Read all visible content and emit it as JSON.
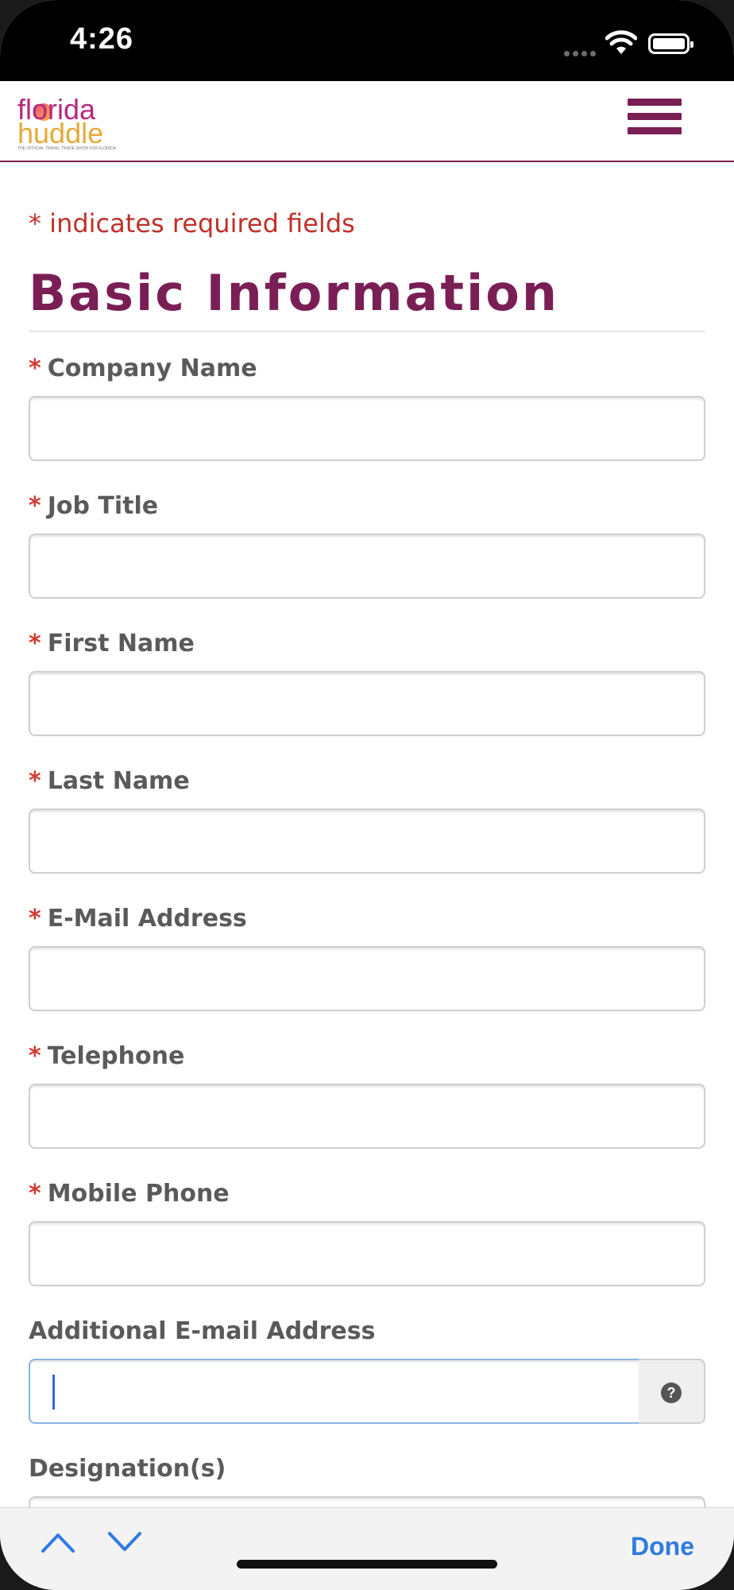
{
  "status_bar": {
    "time": "4:26",
    "icons": [
      "cellular-dots-icon",
      "wifi-icon",
      "battery-icon"
    ]
  },
  "header": {
    "logo": {
      "line1": "florida",
      "line2": "huddle",
      "tagline": "THE OFFICIAL TRAVEL TRADE SHOW FOR FLORIDA"
    },
    "menu_icon": "hamburger-menu-icon",
    "brand_color": "#7a1f55"
  },
  "form": {
    "required_note": "* indicates required fields",
    "section_title": "Basic Information",
    "required_marker": "*",
    "fields": [
      {
        "label": "Company Name",
        "required": true,
        "value": ""
      },
      {
        "label": "Job Title",
        "required": true,
        "value": ""
      },
      {
        "label": "First Name",
        "required": true,
        "value": ""
      },
      {
        "label": "Last Name",
        "required": true,
        "value": ""
      },
      {
        "label": "E-Mail Address",
        "required": true,
        "value": ""
      },
      {
        "label": "Telephone",
        "required": true,
        "value": ""
      },
      {
        "label": "Mobile Phone",
        "required": true,
        "value": ""
      },
      {
        "label": "Additional E-mail Address",
        "required": false,
        "value": "",
        "focused": true,
        "help_icon": "question-circle-icon"
      },
      {
        "label": "Designation(s)",
        "required": false,
        "value": ""
      }
    ]
  },
  "keyboard_toolbar": {
    "prev_icon": "chevron-up-icon",
    "next_icon": "chevron-down-icon",
    "done_label": "Done"
  },
  "colors": {
    "required": "#d43a31",
    "note": "#c0302a",
    "title": "#7a1f55",
    "focus": "#8bb5e2",
    "done": "#2f7be0"
  }
}
